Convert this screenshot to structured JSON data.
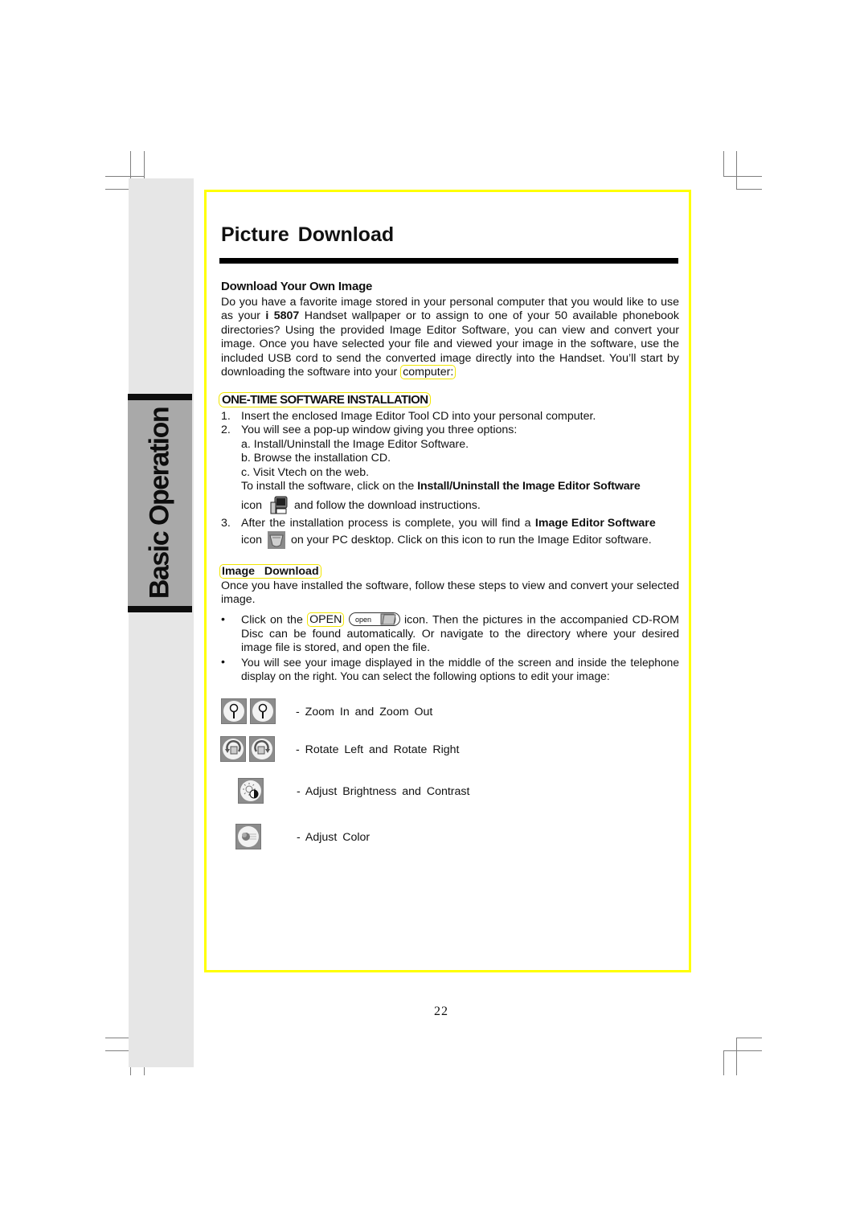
{
  "side_tab": {
    "label": "Basic Operation"
  },
  "page": {
    "title": "Picture Download",
    "page_number": "22"
  },
  "intro": {
    "heading": "Download Your Own Image",
    "text_1": "Do you have a favorite image stored in your personal computer that you would like to use as your ",
    "model_bold": "i 5807",
    "text_2": " Handset wallpaper or to assign to one of your 50 available phonebook directories? Using the provided Image Editor Software, you can view and convert your image. Once you have selected your file and viewed your image in the software, use the included USB cord to send the converted image directly into the Handset. You’ll start by downloading the software into your ",
    "highlight_word": "computer:"
  },
  "installation": {
    "heading": "ONE-TIME SOFTWARE INSTALLATION",
    "steps": [
      {
        "num": "1.",
        "text": "Insert the enclosed Image Editor Tool CD into your personal computer."
      },
      {
        "num": "2.",
        "text": "You will see a pop-up window giving you three options:"
      }
    ],
    "options": [
      "a. Install/Uninstall the Image Editor Software.",
      "b. Browse the installation CD.",
      "c. Visit Vtech on the web."
    ],
    "install_text_1": "To install the software, click on the ",
    "install_bold": "Install/Uninstall the Image Editor Software",
    "install_text_2": "icon",
    "install_text_3": "and follow the download instructions.",
    "step3_num": "3.",
    "step3_text_1": "After the installation process is complete, you will find a ",
    "step3_bold": "Image Editor Software",
    "step3_text_2": "icon",
    "step3_text_3": "on your PC desktop. Click on this icon to run the Image Editor software."
  },
  "image_download": {
    "heading": "Image   Download",
    "intro": "Once you have installed the software, follow these steps to view and convert your selected image.",
    "bullet_char": "•",
    "bullet1_text_1": "Click on the ",
    "bullet1_highlight": "OPEN",
    "open_button_label": "open",
    "bullet1_text_2": " icon. Then the pictures in the accompanied CD-ROM Disc can be found automatically. Or navigate to the directory where your desired image file is stored, and open the file.",
    "bullet2_text": "You will see your image displayed in the middle of the screen and inside the telephone display on the right. You can select the following options to edit your image:"
  },
  "tools": [
    {
      "label": "- Zoom  In  and  Zoom  Out",
      "icons": [
        "zoom-in-icon",
        "zoom-out-icon"
      ]
    },
    {
      "label": "- Rotate  Left  and  Rotate  Right",
      "icons": [
        "rotate-left-icon",
        "rotate-right-icon"
      ]
    },
    {
      "label": "- Adjust  Brightness  and  Contrast",
      "icons": [
        "brightness-contrast-icon"
      ]
    },
    {
      "label": "- Adjust  Color",
      "icons": [
        "adjust-color-icon"
      ]
    }
  ],
  "colors": {
    "highlight": "#ffff00",
    "sidebar": "#e6e6e6",
    "tab": "#a9a9a9"
  }
}
